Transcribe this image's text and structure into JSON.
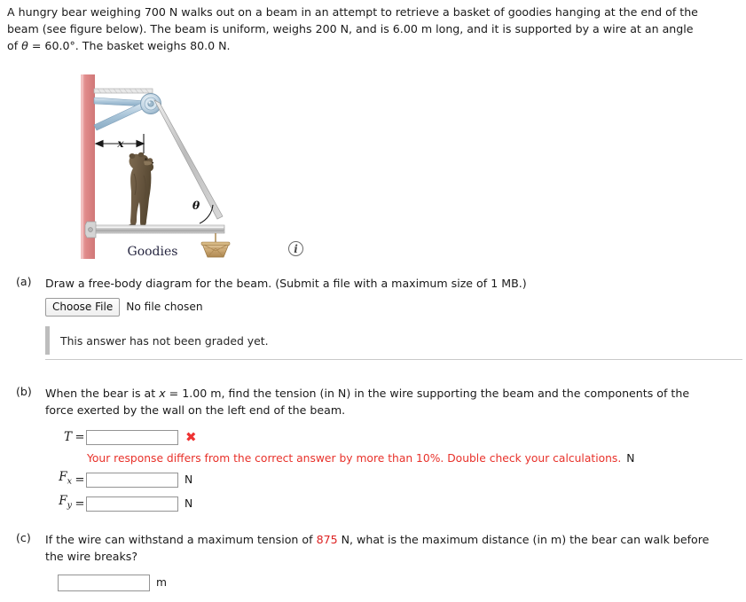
{
  "problem": {
    "line1": "A hungry bear weighing 700 N walks out on a beam in an attempt to retrieve a basket of goodies hanging at the end of the",
    "line2_a": "beam (see figure below). The beam is uniform, weighs 200 N, and is 6.00 m long, and it is supported by a wire at an angle",
    "line3_a": "of ",
    "line3_theta": "θ",
    "line3_b": " = 60.0°. The basket weighs 80.0 N."
  },
  "figure": {
    "x_label": "x",
    "theta_label": "θ",
    "goodies_label": "Goodies",
    "info_icon": "i",
    "colors": {
      "wall": "#e08a8a",
      "beam": "#c9c9c9",
      "wire": "#b9b9b9",
      "bear": "#6e5c45",
      "basket": "#c9a97a",
      "strut": "#a8c4d8"
    }
  },
  "parts": {
    "a": {
      "label": "(a)",
      "question": "Draw a free-body diagram for the beam. (Submit a file with a maximum size of 1 MB.)",
      "choose_file_label": "Choose File",
      "no_file_text": "No file chosen",
      "graded_notice": "This answer has not been graded yet."
    },
    "b": {
      "label": "(b)",
      "question_line1_a": "When the bear is at ",
      "question_line1_x": "x",
      "question_line1_b": " = 1.00 m, find the tension (in N) in the wire supporting the beam and the components of the",
      "question_line2": "force exerted by the wall on the left end of the beam.",
      "fields": [
        {
          "symbol": "T",
          "sub": "",
          "value": "",
          "unit": ""
        },
        {
          "symbol": "F",
          "sub": "x",
          "value": "",
          "unit": "N"
        },
        {
          "symbol": "F",
          "sub": "y",
          "value": "",
          "unit": "N"
        }
      ],
      "equals": "=",
      "error_mark": "✖",
      "error_message": "Your response differs from the correct answer by more than 10%. Double check your calculations.",
      "error_unit": "N"
    },
    "c": {
      "label": "(c)",
      "question_a": "If the wire can withstand a maximum tension of ",
      "question_value": "875",
      "question_b": " N, what is the maximum distance (in m) the bear can walk before",
      "question_line2": "the wire breaks?",
      "value": "",
      "unit": "m"
    }
  }
}
